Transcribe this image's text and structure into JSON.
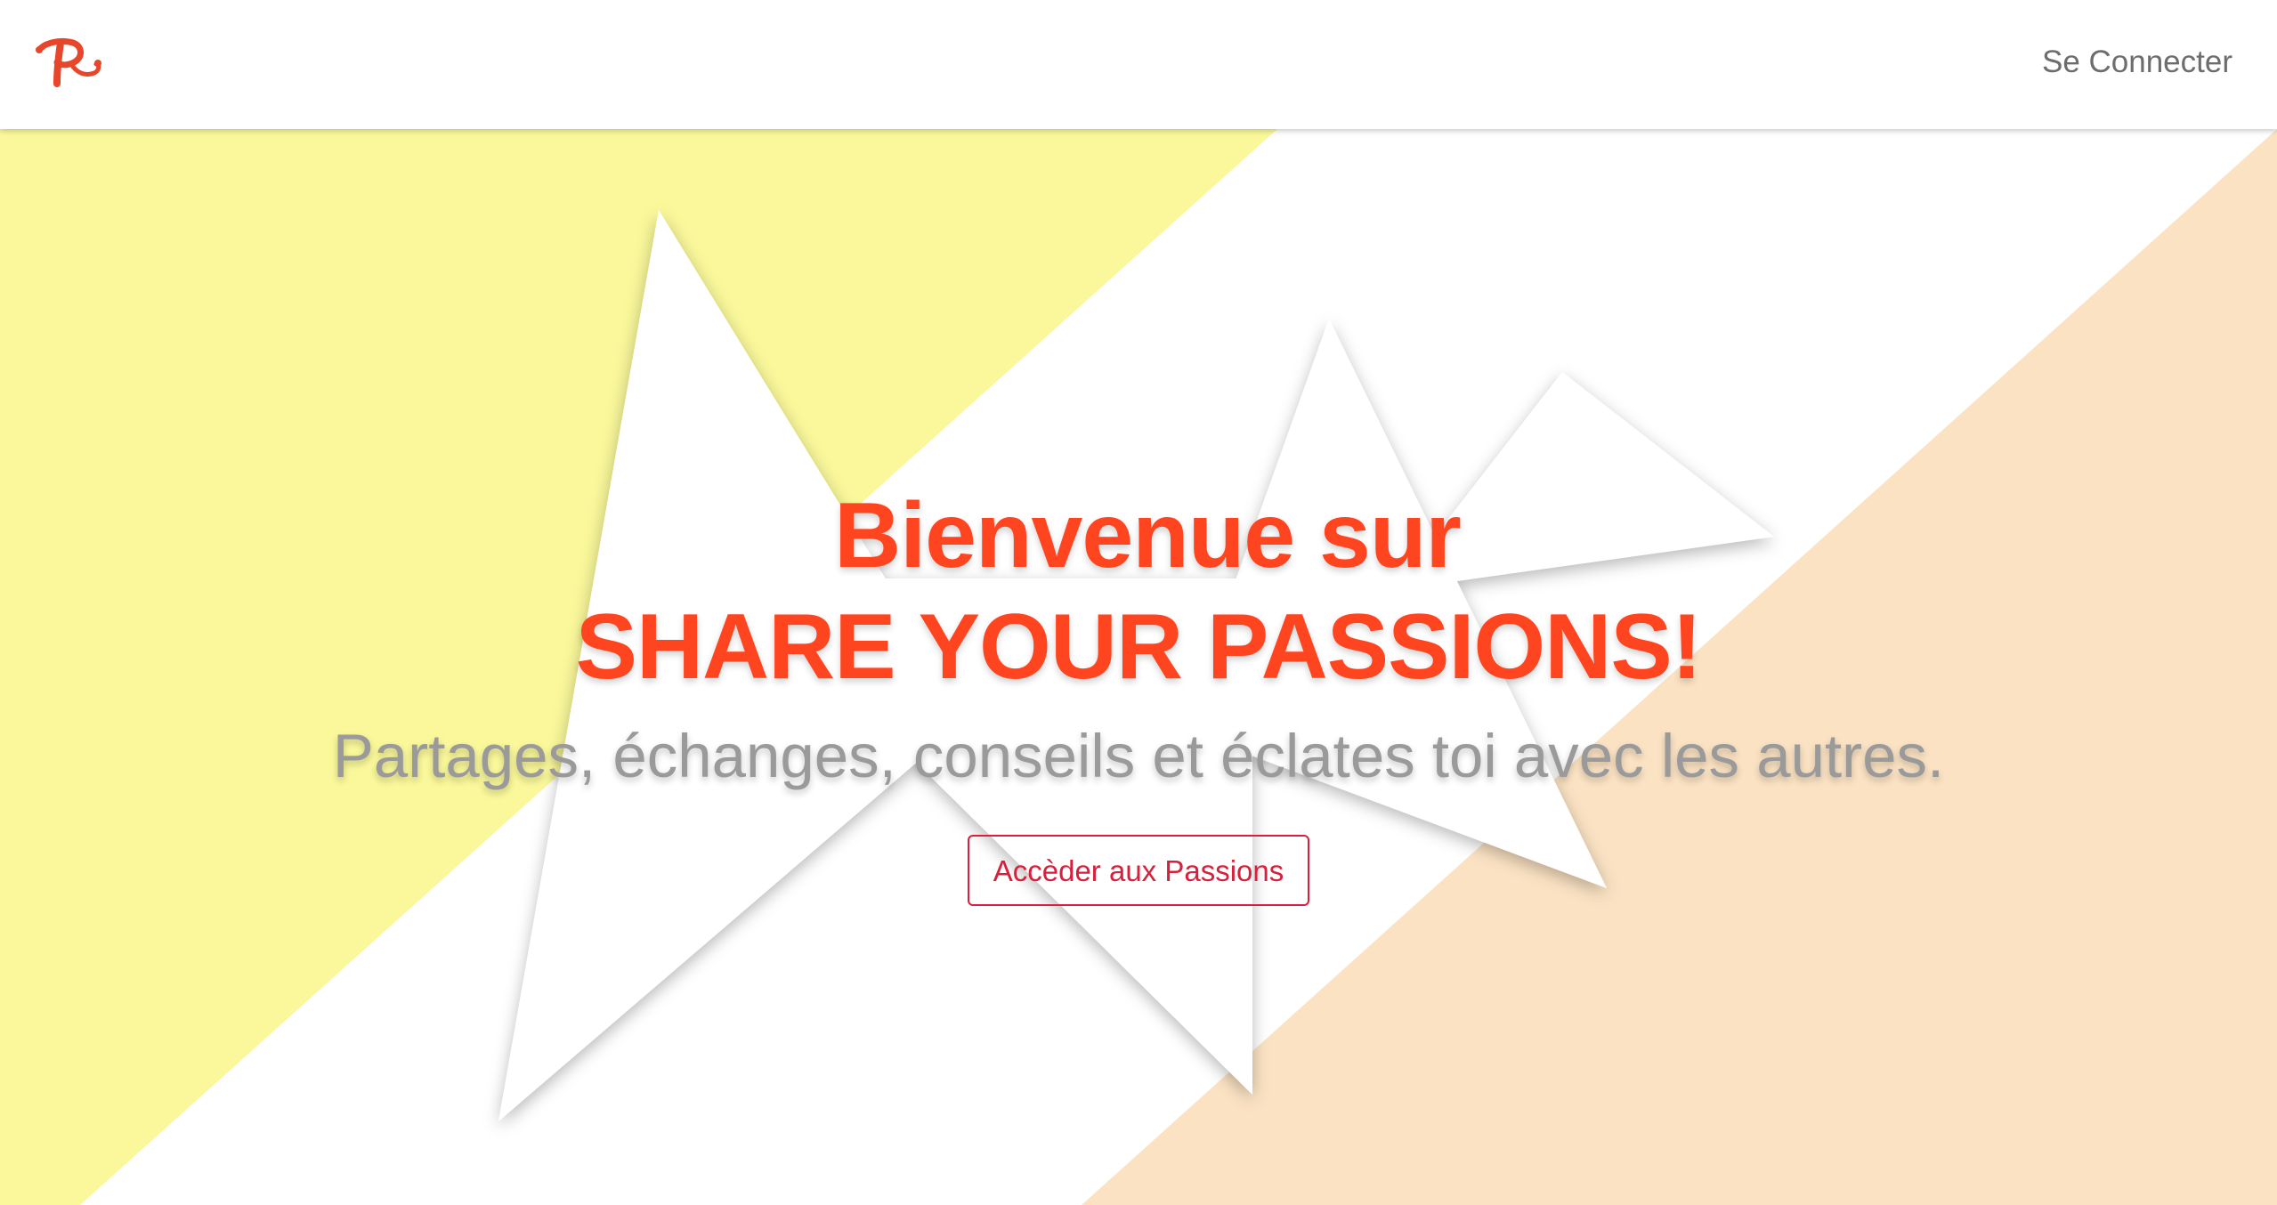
{
  "navbar": {
    "logo_icon": "passions-p-logo-icon",
    "login_label": "Se Connecter"
  },
  "hero": {
    "title_line1": "Bienvenue sur",
    "title_line2": "SHARE YOUR PASSIONS!",
    "subtitle": "Partages, échanges, conseils et éclates toi avec les autres.",
    "cta_label": "Accèder aux Passions"
  },
  "colors": {
    "accent": "#ff4520",
    "button": "#d81f3b",
    "yellow_panel": "#faf89a",
    "peach_panel": "#fbe2c3",
    "subtitle": "#9a9a9a",
    "nav_text": "#6d6d6d"
  }
}
